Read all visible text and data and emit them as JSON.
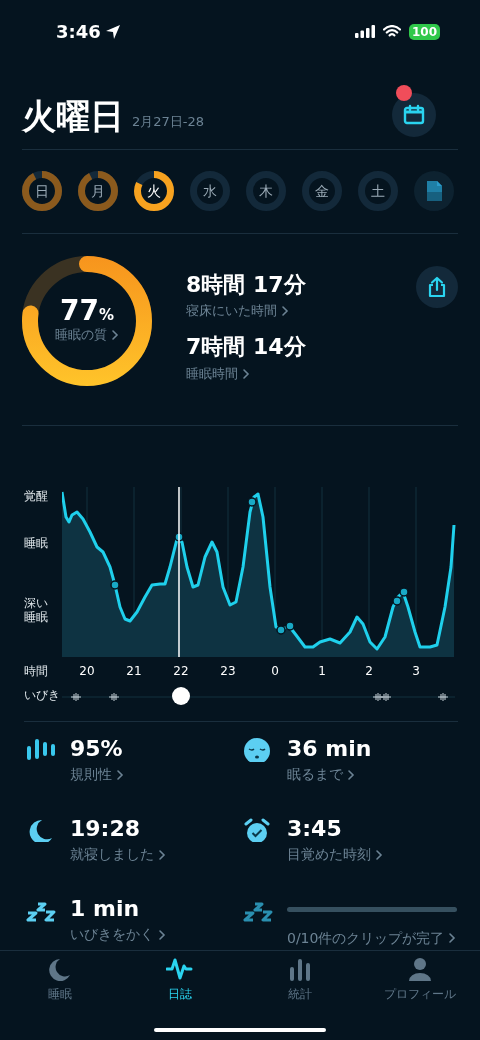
{
  "status_bar": {
    "time": "3:46",
    "battery": "100"
  },
  "header": {
    "title": "火曜日",
    "date": "2月27日-28",
    "calendar_badge": true
  },
  "days": [
    {
      "label": "日",
      "recorded": true,
      "selected": false
    },
    {
      "label": "月",
      "recorded": true,
      "selected": false
    },
    {
      "label": "火",
      "recorded": true,
      "selected": true
    },
    {
      "label": "水",
      "recorded": false,
      "selected": false
    },
    {
      "label": "木",
      "recorded": false,
      "selected": false
    },
    {
      "label": "金",
      "recorded": false,
      "selected": false
    },
    {
      "label": "土",
      "recorded": false,
      "selected": false
    }
  ],
  "summary": {
    "score": "77",
    "unit": "%",
    "score_label": "睡眠の質",
    "level": 0.77,
    "stats": [
      {
        "value": "8時間 17分",
        "label": "寝床にいた時間"
      },
      {
        "value": "7時間 14分",
        "label": "睡眠時間"
      }
    ]
  },
  "chart": {
    "y_labels": [
      "覚醒",
      "睡眠",
      "深い睡眠"
    ],
    "x_label": "時間",
    "x_ticks": [
      "20",
      "21",
      "22",
      "23",
      "0",
      "1",
      "2",
      "3"
    ],
    "snore_label": "いびき",
    "level": 0.3
  },
  "metrics": [
    {
      "kind": "value",
      "value": "95%",
      "label": "規則性"
    },
    {
      "kind": "value",
      "value": "36 min",
      "label": "眠るまで"
    },
    {
      "kind": "value",
      "value": "19:28",
      "label": "就寝しました"
    },
    {
      "kind": "value",
      "value": "3:45",
      "label": "目覚めた時刻"
    },
    {
      "kind": "value",
      "value": "1 min",
      "label": "いびきをかく"
    },
    {
      "kind": "progress",
      "label": "0/10件のクリップが完了"
    }
  ],
  "nav": [
    {
      "label": "睡眠",
      "selected": false
    },
    {
      "label": "日誌",
      "selected": true
    },
    {
      "label": "統計",
      "selected": false
    },
    {
      "label": "プロフィール",
      "selected": false
    }
  ]
}
